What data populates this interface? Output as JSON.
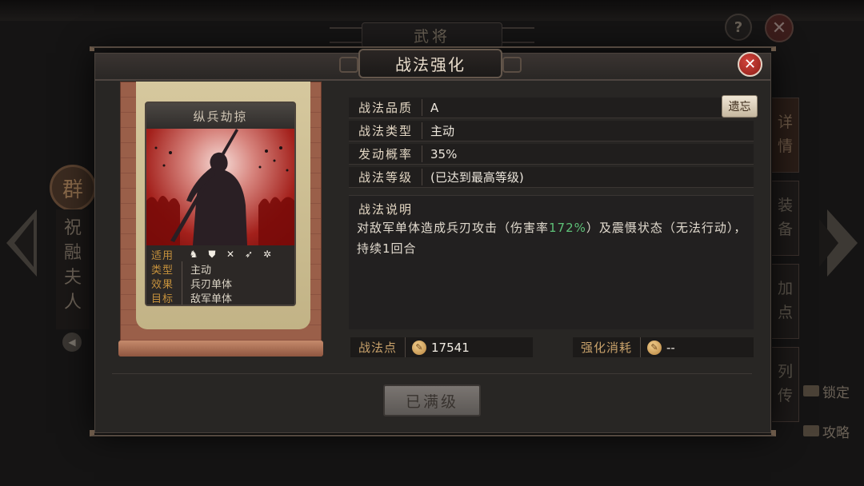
{
  "background": {
    "window_title": "武将",
    "help_label": "?",
    "close_label": "✕",
    "faction": "群",
    "hero_name": "祝融夫人",
    "side_tabs": [
      "详情",
      "装备",
      "加点",
      "列传"
    ],
    "bottom_links": [
      "锁定",
      "攻略"
    ]
  },
  "modal": {
    "title": "战法强化",
    "close_label": "✕"
  },
  "card": {
    "name": "纵兵劫掠",
    "stats": {
      "applicable_label": "适用",
      "troop_icons": [
        "cavalry-icon",
        "shield-icon",
        "bow-icon",
        "spear-icon",
        "wheel-icon"
      ],
      "type_label": "类型",
      "type_value": "主动",
      "effect_label": "效果",
      "effect_value": "兵刃单体",
      "target_label": "目标",
      "target_value": "敌军单体"
    }
  },
  "info": {
    "quality_label": "战法品质",
    "quality_value": "A",
    "forget_label": "遗忘",
    "type_label": "战法类型",
    "type_value": "主动",
    "rate_label": "发动概率",
    "rate_value": "35%",
    "level_label": "战法等级",
    "level_value": "(已达到最高等级)",
    "desc_title": "战法说明",
    "desc_part1": "对敌军单体造成兵刃攻击（伤害率",
    "desc_highlight": "172%",
    "desc_part2": "）及震慑状态（无法行动），持续1回合",
    "points_label": "战法点",
    "points_value": "17541",
    "cost_label": "强化消耗",
    "cost_value": "--"
  },
  "actions": {
    "max_level_label": "已满级"
  },
  "colors": {
    "accent_gold": "#c9a26b",
    "highlight_green": "#5ec178",
    "close_red": "#c0372f"
  }
}
